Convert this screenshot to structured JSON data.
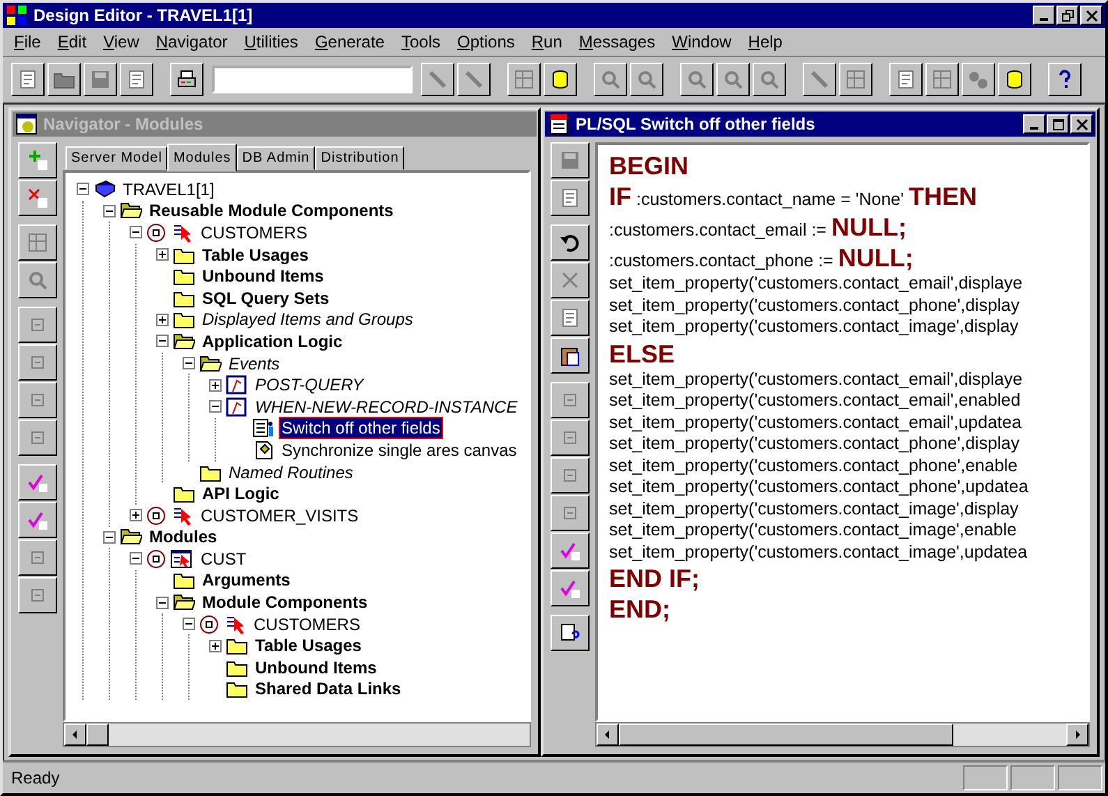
{
  "window": {
    "title": "Design Editor - TRAVEL1[1]"
  },
  "menu": [
    "File",
    "Edit",
    "View",
    "Navigator",
    "Utilities",
    "Generate",
    "Tools",
    "Options",
    "Run",
    "Messages",
    "Window",
    "Help"
  ],
  "navigator": {
    "title": "Navigator - Modules",
    "active": false,
    "tabs": [
      {
        "label": "Server Model",
        "selected": false
      },
      {
        "label": "Modules",
        "selected": true
      },
      {
        "label": "DB Admin",
        "selected": false
      },
      {
        "label": "Distribution",
        "selected": false
      }
    ],
    "tree": [
      {
        "label": "TRAVEL1[1]",
        "kind": "application",
        "expanded": true,
        "selected": false,
        "children": [
          {
            "label": "Reusable Module Components",
            "kind": "folder",
            "expanded": true,
            "selected": false,
            "children": [
              {
                "label": "CUSTOMERS",
                "kind": "component",
                "expanded": true,
                "selected": false,
                "children": [
                  {
                    "label": "Table Usages",
                    "kind": "folder",
                    "expanded": false,
                    "selected": false
                  },
                  {
                    "label": "Unbound Items",
                    "kind": "folder",
                    "selected": false
                  },
                  {
                    "label": "SQL Query Sets",
                    "kind": "folder",
                    "selected": false
                  },
                  {
                    "label": "Displayed Items and Groups",
                    "kind": "folder_italic",
                    "expanded": false,
                    "selected": false
                  },
                  {
                    "label": "Application Logic",
                    "kind": "folder",
                    "expanded": true,
                    "selected": false,
                    "children": [
                      {
                        "label": "Events",
                        "kind": "folder_italic",
                        "expanded": true,
                        "selected": false,
                        "children": [
                          {
                            "label": "POST-QUERY",
                            "kind": "event",
                            "expanded": false,
                            "selected": false
                          },
                          {
                            "label": "WHEN-NEW-RECORD-INSTANCE",
                            "kind": "event",
                            "expanded": true,
                            "selected": false,
                            "children": [
                              {
                                "label": "Switch off other fields",
                                "kind": "code",
                                "selected": true
                              },
                              {
                                "label": "Synchronize single ares canvas",
                                "kind": "routine",
                                "selected": false
                              }
                            ]
                          }
                        ]
                      },
                      {
                        "label": "Named Routines",
                        "kind": "folder_italic",
                        "selected": false
                      }
                    ]
                  },
                  {
                    "label": "API Logic",
                    "kind": "folder",
                    "selected": false
                  }
                ]
              },
              {
                "label": "CUSTOMER_VISITS",
                "kind": "component",
                "expanded": false,
                "selected": false
              }
            ]
          },
          {
            "label": "Modules",
            "kind": "folder",
            "expanded": true,
            "selected": false,
            "children": [
              {
                "label": "CUST",
                "kind": "module",
                "expanded": true,
                "selected": false,
                "children": [
                  {
                    "label": "Arguments",
                    "kind": "folder",
                    "selected": false
                  },
                  {
                    "label": "Module Components",
                    "kind": "folder",
                    "expanded": true,
                    "selected": false,
                    "children": [
                      {
                        "label": "CUSTOMERS",
                        "kind": "component",
                        "expanded": true,
                        "selected": false,
                        "children": [
                          {
                            "label": "Table Usages",
                            "kind": "folder",
                            "expanded": false,
                            "selected": false
                          },
                          {
                            "label": "Unbound Items",
                            "kind": "folder",
                            "selected": false
                          },
                          {
                            "label": "Shared Data Links",
                            "kind": "folder",
                            "selected": false
                          }
                        ]
                      }
                    ]
                  }
                ]
              }
            ]
          }
        ]
      }
    ]
  },
  "editor": {
    "title": "PL/SQL Switch off other fields",
    "active": true,
    "lines": [
      [
        {
          "kind": "keyword",
          "text": "BEGIN"
        }
      ],
      [
        {
          "kind": "keyword",
          "text": "IF"
        },
        {
          "kind": "code",
          "text": " :customers.contact_name = 'None' "
        },
        {
          "kind": "keyword",
          "text": "THEN"
        }
      ],
      [
        {
          "kind": "code",
          "text": ":customers.contact_email := "
        },
        {
          "kind": "keyword",
          "text": "NULL;"
        }
      ],
      [
        {
          "kind": "code",
          "text": ":customers.contact_phone := "
        },
        {
          "kind": "keyword",
          "text": "NULL;"
        }
      ],
      [
        {
          "kind": "code",
          "text": "set_item_property('customers.contact_email',displaye"
        }
      ],
      [
        {
          "kind": "code",
          "text": "set_item_property('customers.contact_phone',display"
        }
      ],
      [
        {
          "kind": "code",
          "text": "set_item_property('customers.contact_image',display"
        }
      ],
      [
        {
          "kind": "keyword",
          "text": "ELSE"
        }
      ],
      [
        {
          "kind": "code",
          "text": "set_item_property('customers.contact_email',displaye"
        }
      ],
      [
        {
          "kind": "code",
          "text": "set_item_property('customers.contact_email',enabled"
        }
      ],
      [
        {
          "kind": "code",
          "text": "set_item_property('customers.contact_email',updatea"
        }
      ],
      [
        {
          "kind": "code",
          "text": "set_item_property('customers.contact_phone',display"
        }
      ],
      [
        {
          "kind": "code",
          "text": "set_item_property('customers.contact_phone',enable"
        }
      ],
      [
        {
          "kind": "code",
          "text": "set_item_property('customers.contact_phone',updatea"
        }
      ],
      [
        {
          "kind": "code",
          "text": "set_item_property('customers.contact_image',display"
        }
      ],
      [
        {
          "kind": "code",
          "text": "set_item_property('customers.contact_image',enable"
        }
      ],
      [
        {
          "kind": "code",
          "text": "set_item_property('customers.contact_image',updatea"
        }
      ],
      [
        {
          "kind": "keyword",
          "text": "END IF;"
        }
      ],
      [
        {
          "kind": "keyword",
          "text": "END;"
        }
      ]
    ]
  },
  "status_bar": {
    "text": "Ready"
  }
}
